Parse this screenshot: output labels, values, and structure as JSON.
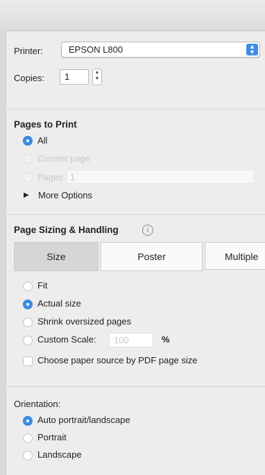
{
  "printer": {
    "label": "Printer:",
    "value": "EPSON L800"
  },
  "copies": {
    "label": "Copies:",
    "value": "1"
  },
  "pages_to_print": {
    "heading": "Pages to Print",
    "all": "All",
    "current_page": "Current page",
    "pages": "Pages",
    "pages_value": "1",
    "more_options": "More Options"
  },
  "page_sizing": {
    "heading": "Page Sizing & Handling",
    "info_icon": "i",
    "tabs": [
      "Size",
      "Poster",
      "Multiple"
    ],
    "fit": "Fit",
    "actual_size": "Actual size",
    "shrink": "Shrink oversized pages",
    "custom_scale": "Custom Scale:",
    "custom_scale_value": "100",
    "percent": "%",
    "paper_source": "Choose paper source by PDF page size"
  },
  "orientation": {
    "label": "Orientation:",
    "auto": "Auto portrait/landscape",
    "portrait": "Portrait",
    "landscape": "Landscape"
  },
  "colors": {
    "accent": "#3a8ee8",
    "panel": "#ededed"
  }
}
